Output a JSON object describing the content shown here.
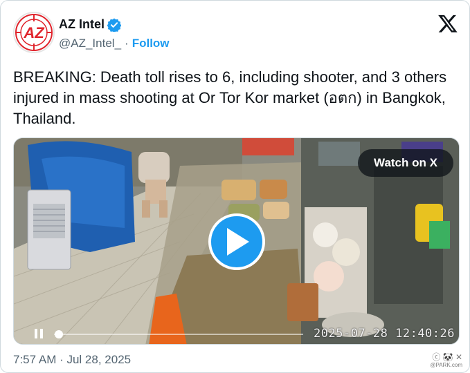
{
  "author": {
    "display_name": "AZ Intel",
    "handle": "@AZ_Intel_",
    "separator": "·",
    "follow_label": "Follow",
    "avatar_text": "AZ",
    "brand_color": "#e0242c"
  },
  "tweet": {
    "text": "BREAKING: Death toll rises to 6, including shooter, and 3 others injured in mass shooting at Or Tor Kor market (อตก) in Bangkok, Thailand."
  },
  "media": {
    "watch_label": "Watch on X",
    "video_timestamp": "2025-07-28 12:40:26",
    "progress_fraction": 0.02
  },
  "footer": {
    "timestamp": "7:57 AM · Jul 28, 2025"
  },
  "watermark": {
    "text": "ⓒ 🐼 ✕",
    "subtext": "@PARK.com"
  },
  "colors": {
    "accent": "#1d9bf0",
    "text_primary": "#0f1419",
    "text_secondary": "#536471"
  }
}
